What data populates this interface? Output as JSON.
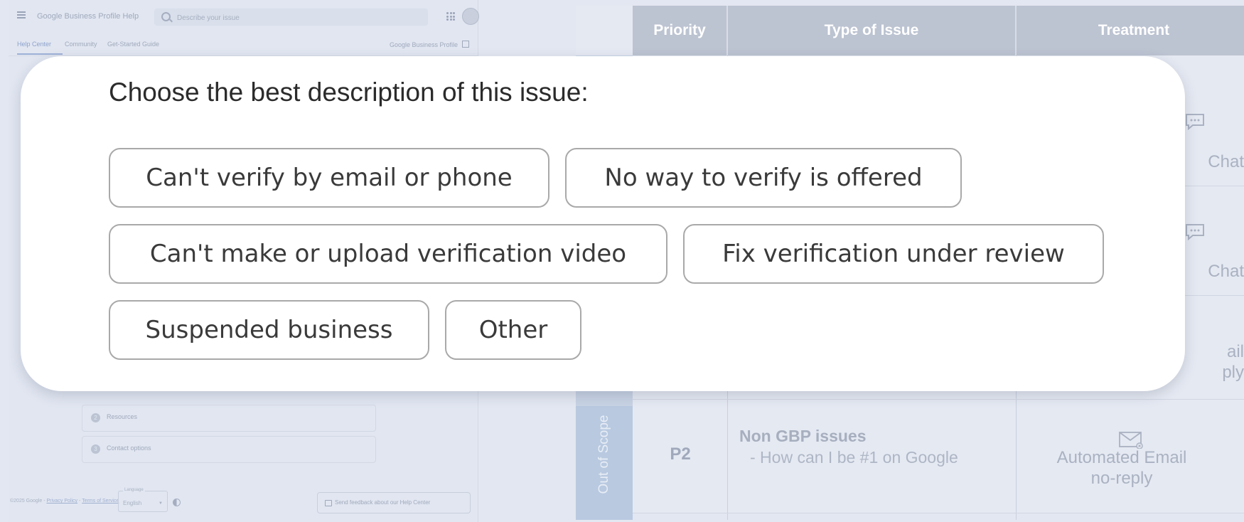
{
  "help_center": {
    "app_title": "Google Business Profile Help",
    "search_placeholder": "Describe your issue",
    "tabs": [
      "Help Center",
      "Community",
      "Get-Started Guide"
    ],
    "external_link": "Google Business Profile",
    "steps": [
      {
        "num": "2",
        "label": "Resources"
      },
      {
        "num": "3",
        "label": "Contact options"
      }
    ],
    "footer": {
      "copyright": "©2025 Google -",
      "privacy": "Privacy Policy",
      "separator": "-",
      "terms": "Terms of Service"
    },
    "language": {
      "legend": "Language",
      "value": "English"
    },
    "feedback_label": "Send feedback about our Help Center"
  },
  "table": {
    "headers": [
      "Priority",
      "Type of Issue",
      "Treatment"
    ],
    "rows_visible_fragments": {
      "chat_1": "Chat",
      "chat_2": "Chat",
      "email_fragment_1": "ail",
      "email_fragment_2": "ply"
    },
    "out_of_scope_row": {
      "band_label": "Out of Scope",
      "priority": "P2",
      "issue_title": "Non GBP issues",
      "issue_items": [
        "-   How can I be #1 on Google"
      ],
      "treatment_line1": "Automated Email",
      "treatment_line2": "no-reply"
    }
  },
  "dialog": {
    "prompt": "Choose the best description of this issue:",
    "options": [
      "Can't verify by email or phone",
      "No way to verify is offered",
      "Can't make or upload verification video",
      "Fix verification under review",
      "Suspended business",
      "Other"
    ]
  },
  "colors": {
    "background": "#e3e7f1",
    "header_fill": "#bcc3d1",
    "band_fill": "#b8c9e0",
    "option_border": "#a9a9a9"
  }
}
